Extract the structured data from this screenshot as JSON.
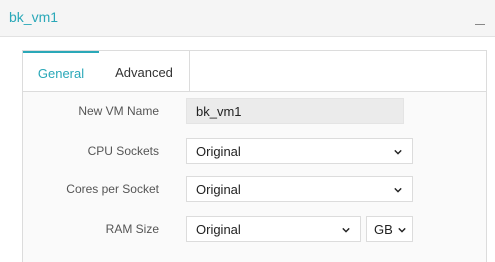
{
  "panel": {
    "title": "bk_vm1"
  },
  "tabs": [
    {
      "label": "General",
      "active": true
    },
    {
      "label": "Advanced",
      "active": false
    }
  ],
  "form": {
    "vm_name": {
      "label": "New VM Name",
      "value": "bk_vm1"
    },
    "cpu_sockets": {
      "label": "CPU Sockets",
      "value": "Original"
    },
    "cores_per_socket": {
      "label": "Cores per Socket",
      "value": "Original"
    },
    "ram_size": {
      "label": "RAM Size",
      "value": "Original",
      "unit": "GB"
    }
  },
  "colors": {
    "accent": "#2aa8b8"
  },
  "icons": {
    "collapse": "minus-icon",
    "dropdown": "chevron-down-icon"
  }
}
